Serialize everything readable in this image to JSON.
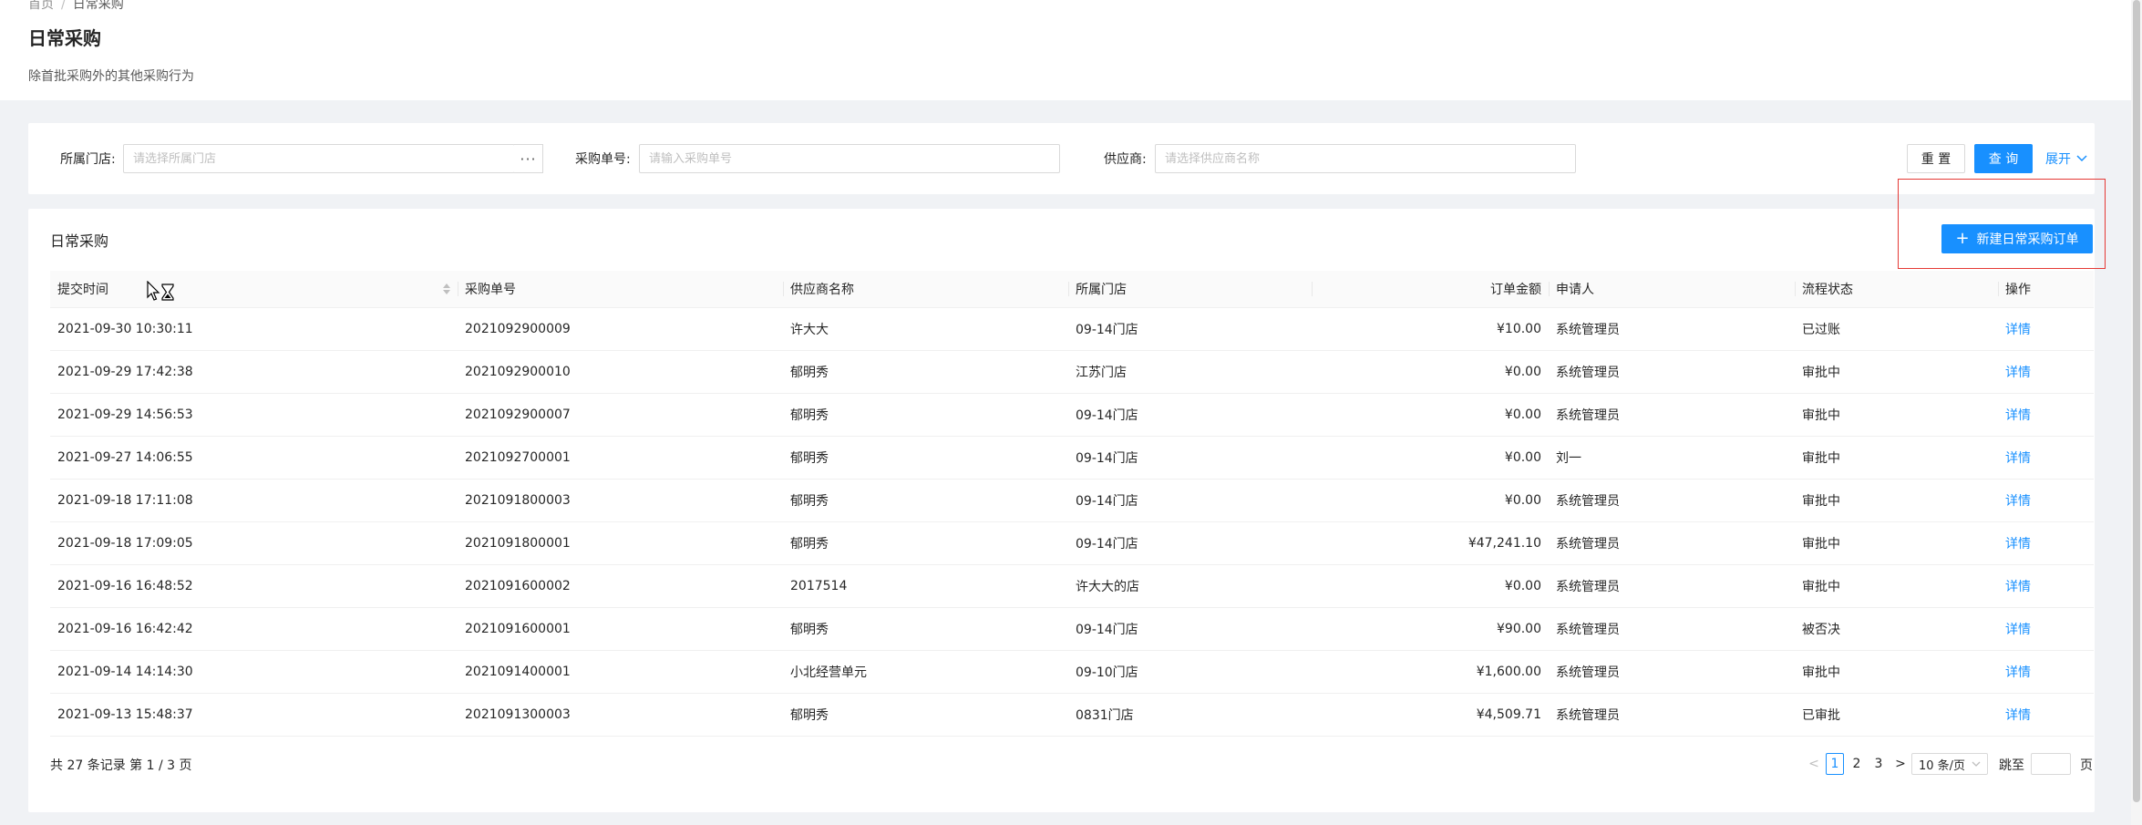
{
  "breadcrumb": {
    "home": "首页",
    "separator": "/",
    "current": "日常采购"
  },
  "page": {
    "title": "日常采购",
    "description": "除首批采购外的其他采购行为"
  },
  "filters": {
    "store": {
      "label": "所属门店:",
      "placeholder": "请选择所属门店",
      "more_button": "···"
    },
    "purchase_no": {
      "label": "采购单号:",
      "placeholder": "请输入采购单号"
    },
    "supplier": {
      "label": "供应商:",
      "placeholder": "请选择供应商名称"
    },
    "reset_label": "重 置",
    "query_label": "查 询",
    "expand_label": "展开"
  },
  "table_card": {
    "title": "日常采购",
    "new_button_icon": "+",
    "new_button_label": "新建日常采购订单",
    "columns": [
      "提交时间",
      "采购单号",
      "供应商名称",
      "所属门店",
      "订单金额",
      "申请人",
      "流程状态",
      "操作"
    ],
    "rows": [
      [
        "2021-09-30 10:30:11",
        "2021092900009",
        "许大大",
        "09-14门店",
        "¥10.00",
        "系统管理员",
        "已过账",
        "详情"
      ],
      [
        "2021-09-29 17:42:38",
        "2021092900010",
        "郁明秀",
        "江苏门店",
        "¥0.00",
        "系统管理员",
        "审批中",
        "详情"
      ],
      [
        "2021-09-29 14:56:53",
        "2021092900007",
        "郁明秀",
        "09-14门店",
        "¥0.00",
        "系统管理员",
        "审批中",
        "详情"
      ],
      [
        "2021-09-27 14:06:55",
        "2021092700001",
        "郁明秀",
        "09-14门店",
        "¥0.00",
        "刘一",
        "审批中",
        "详情"
      ],
      [
        "2021-09-18 17:11:08",
        "2021091800003",
        "郁明秀",
        "09-14门店",
        "¥0.00",
        "系统管理员",
        "审批中",
        "详情"
      ],
      [
        "2021-09-18 17:09:05",
        "2021091800001",
        "郁明秀",
        "09-14门店",
        "¥47,241.10",
        "系统管理员",
        "审批中",
        "详情"
      ],
      [
        "2021-09-16 16:48:52",
        "2021091600002",
        "2017514",
        "许大大的店",
        "¥0.00",
        "系统管理员",
        "审批中",
        "详情"
      ],
      [
        "2021-09-16 16:42:42",
        "2021091600001",
        "郁明秀",
        "09-14门店",
        "¥90.00",
        "系统管理员",
        "被否决",
        "详情"
      ],
      [
        "2021-09-14 14:14:30",
        "2021091400001",
        "小北经营单元",
        "09-10门店",
        "¥1,600.00",
        "系统管理员",
        "审批中",
        "详情"
      ],
      [
        "2021-09-13 15:48:37",
        "2021091300003",
        "郁明秀",
        "0831门店",
        "¥4,509.71",
        "系统管理员",
        "已审批",
        "详情"
      ]
    ]
  },
  "pagination": {
    "summary": "共 27 条记录 第 1 / 3 页",
    "prev": "<",
    "next": ">",
    "pages": [
      "1",
      "2",
      "3"
    ],
    "active_page": "1",
    "page_size": "10 条/页",
    "jump_label": "跳至",
    "page_suffix": "页"
  },
  "colors": {
    "primary": "#1890ff",
    "highlight": "#e53935",
    "background": "#f0f2f5"
  }
}
